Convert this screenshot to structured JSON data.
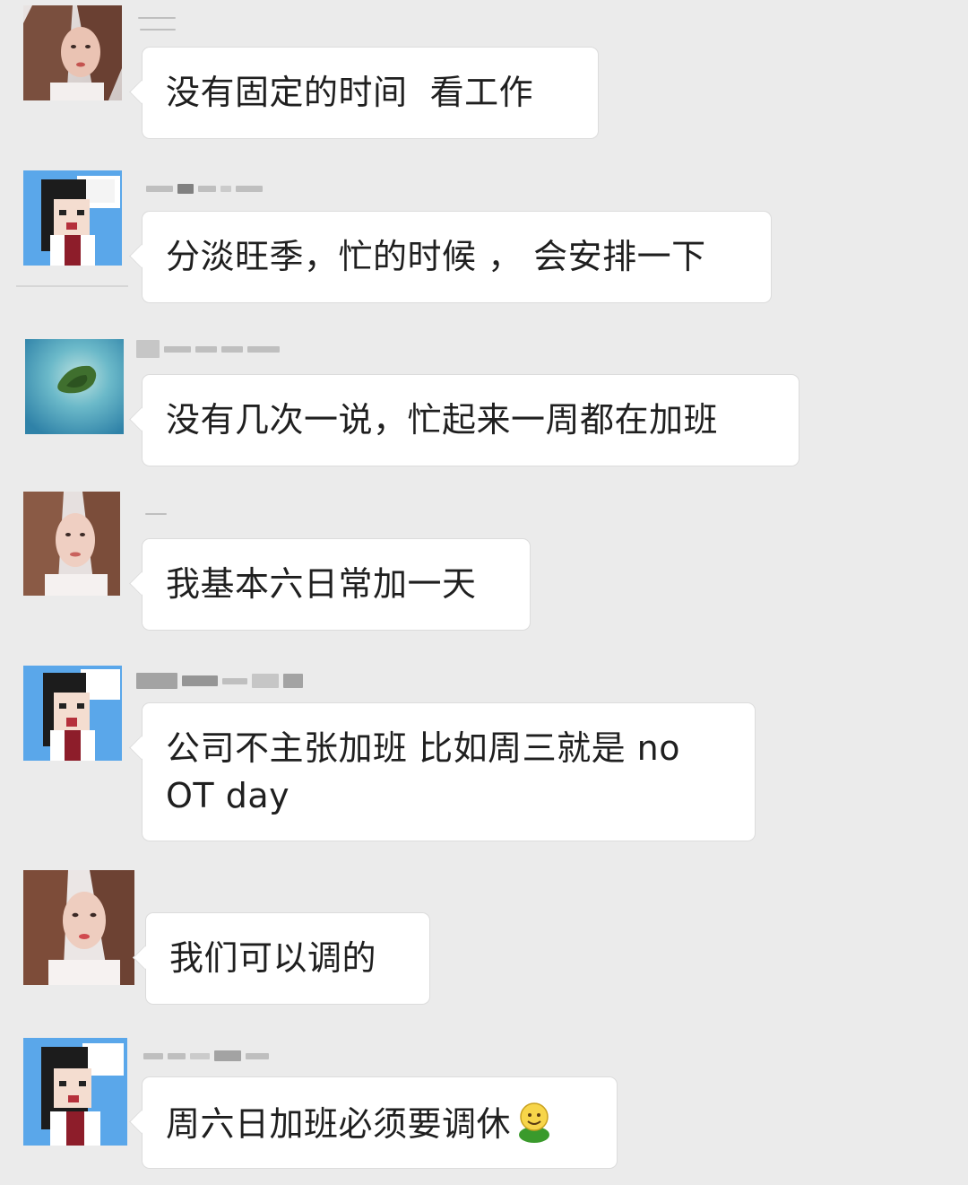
{
  "chat": {
    "messages": [
      {
        "avatar": "female-photo-avatar",
        "text": "没有固定的时间  看工作"
      },
      {
        "avatar": "pixel-cartoon-avatar",
        "text": "分淡旺季，忙的时候 ， 会安排一下"
      },
      {
        "avatar": "island-photo-avatar",
        "text": "没有几次一说，忙起来一周都在加班"
      },
      {
        "avatar": "female-photo-avatar",
        "text": "我基本六日常加一天"
      },
      {
        "avatar": "pixel-cartoon-avatar",
        "text_line1": "公司不主张加班 比如周三就是 no",
        "text_line2": "OT day"
      },
      {
        "avatar": "female-photo-avatar",
        "text": "我们可以调的"
      },
      {
        "avatar": "pixel-cartoon-avatar",
        "text": "周六日加班必须要调休",
        "emoji": "green-smiley-emoji"
      }
    ]
  },
  "colors": {
    "background": "#ebebeb",
    "bubble": "#ffffff",
    "text": "#1f1f1f"
  }
}
